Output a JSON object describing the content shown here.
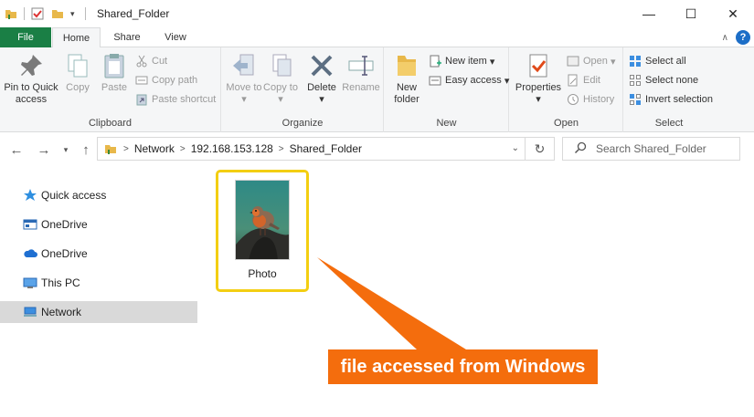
{
  "window": {
    "title": "Shared_Folder",
    "minimize_glyph": "—",
    "maximize_glyph": "☐",
    "close_glyph": "✕"
  },
  "tabs": {
    "file": "File",
    "home": "Home",
    "share": "Share",
    "view": "View",
    "collapse_glyph": "∧",
    "help_glyph": "?"
  },
  "ribbon": {
    "clipboard": {
      "label": "Clipboard",
      "pin": "Pin to Quick access",
      "copy": "Copy",
      "paste": "Paste",
      "cut": "Cut",
      "copy_path": "Copy path",
      "paste_shortcut": "Paste shortcut"
    },
    "organize": {
      "label": "Organize",
      "move_to": "Move to",
      "copy_to": "Copy to",
      "delete": "Delete",
      "rename": "Rename"
    },
    "new": {
      "label": "New",
      "new_folder": "New folder",
      "new_item": "New item",
      "easy_access": "Easy access"
    },
    "open": {
      "label": "Open",
      "properties": "Properties",
      "open": "Open",
      "edit": "Edit",
      "history": "History"
    },
    "select": {
      "label": "Select",
      "select_all": "Select all",
      "select_none": "Select none",
      "invert_selection": "Invert selection"
    }
  },
  "address": {
    "crumbs": [
      "Network",
      "192.168.153.128",
      "Shared_Folder"
    ],
    "search_placeholder": "Search Shared_Folder"
  },
  "sidebar": {
    "items": [
      "Quick access",
      "OneDrive",
      "OneDrive",
      "This PC",
      "Network"
    ]
  },
  "files": [
    {
      "name": "Photo"
    }
  ],
  "callout": {
    "text": "file accessed from Windows",
    "color": "#f46d0d"
  },
  "colors": {
    "file_tab": "#1a7f45",
    "selection_outline": "#f3ce12"
  }
}
